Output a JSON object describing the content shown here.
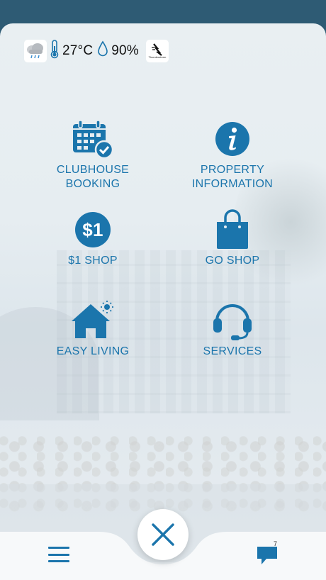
{
  "weather": {
    "condition_icon": "rain-cloud-icon",
    "temperature": "27°C",
    "humidity": "90%",
    "warning_icon": "thunderstorm-warning-icon",
    "warning_label": "Thunderstorm"
  },
  "menu": {
    "items": [
      {
        "label": "CLUBHOUSE\nBOOKING",
        "icon": "calendar-check-icon"
      },
      {
        "label": "PROPERTY\nINFORMATION",
        "icon": "info-icon"
      },
      {
        "label": "$1 SHOP",
        "icon": "dollar-one-icon"
      },
      {
        "label": "GO SHOP",
        "icon": "shopping-bag-icon"
      },
      {
        "label": "EASY LIVING",
        "icon": "house-sun-icon"
      },
      {
        "label": "SERVICES",
        "icon": "headset-icon"
      }
    ]
  },
  "bottom_nav": {
    "menu_icon": "hamburger-menu-icon",
    "close_icon": "close-icon",
    "chat_icon": "chat-bubble-icon",
    "chat_count": "7"
  },
  "colors": {
    "accent": "#1b75ac",
    "header": "#2e5b74"
  }
}
